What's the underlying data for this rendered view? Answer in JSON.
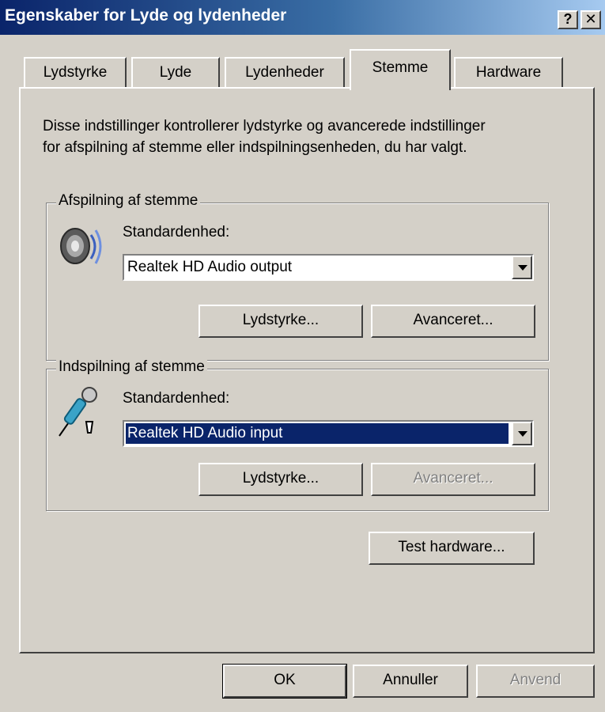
{
  "window": {
    "title": "Egenskaber for Lyde og lydenheder",
    "help_glyph": "?",
    "close_glyph": "✕"
  },
  "tabs": [
    {
      "label": "Lydstyrke",
      "active": false
    },
    {
      "label": "Lyde",
      "active": false
    },
    {
      "label": "Lydenheder",
      "active": false
    },
    {
      "label": "Stemme",
      "active": true
    },
    {
      "label": "Hardware",
      "active": false
    }
  ],
  "description": {
    "line1": "Disse indstillinger kontrollerer lydstyrke og avancerede indstillinger",
    "line2": "for afspilning af stemme eller indspilningsenheden, du har valgt."
  },
  "playback": {
    "legend": "Afspilning af stemme",
    "icon": "speaker-icon",
    "device_label": "Standardenhed:",
    "device_value": "Realtek HD Audio output",
    "volume_button": "Lydstyrke...",
    "advanced_button": "Avanceret...",
    "advanced_enabled": true
  },
  "recording": {
    "legend": "Indspilning af stemme",
    "icon": "microphone-icon",
    "device_label": "Standardenhed:",
    "device_value": "Realtek HD Audio input",
    "volume_button": "Lydstyrke...",
    "advanced_button": "Avanceret...",
    "advanced_enabled": false
  },
  "test_button": "Test hardware...",
  "footer": {
    "ok": "OK",
    "cancel": "Annuller",
    "apply": "Anvend",
    "apply_enabled": false
  },
  "colors": {
    "face": "#d4d0c8",
    "title_start": "#0a246a",
    "title_end": "#a6caf0",
    "selection": "#0a246a"
  }
}
